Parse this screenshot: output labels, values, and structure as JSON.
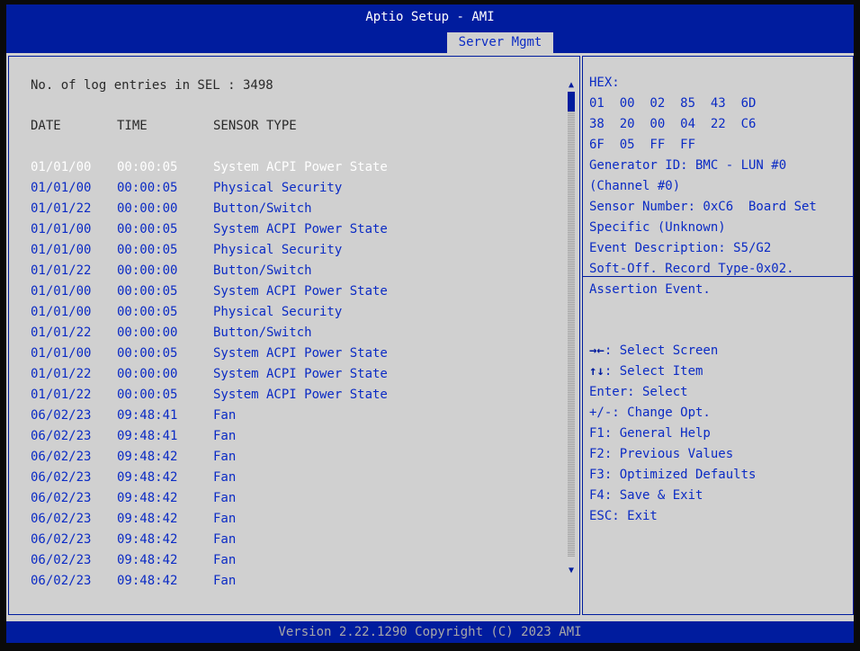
{
  "header": {
    "title": "Aptio Setup - AMI",
    "tab": "Server Mgmt"
  },
  "main": {
    "entries_label": "No. of log entries in SEL : 3498",
    "columns": [
      "DATE",
      "TIME",
      "SENSOR TYPE"
    ],
    "rows": [
      {
        "date": "01/01/00",
        "time": "00:00:05",
        "sensor": "System ACPI Power State"
      },
      {
        "date": "01/01/00",
        "time": "00:00:05",
        "sensor": "Physical Security"
      },
      {
        "date": "01/01/22",
        "time": "00:00:00",
        "sensor": "Button/Switch"
      },
      {
        "date": "01/01/00",
        "time": "00:00:05",
        "sensor": "System ACPI Power State"
      },
      {
        "date": "01/01/00",
        "time": "00:00:05",
        "sensor": "Physical Security"
      },
      {
        "date": "01/01/22",
        "time": "00:00:00",
        "sensor": "Button/Switch"
      },
      {
        "date": "01/01/00",
        "time": "00:00:05",
        "sensor": "System ACPI Power State"
      },
      {
        "date": "01/01/00",
        "time": "00:00:05",
        "sensor": "Physical Security"
      },
      {
        "date": "01/01/22",
        "time": "00:00:00",
        "sensor": "Button/Switch"
      },
      {
        "date": "01/01/00",
        "time": "00:00:05",
        "sensor": "System ACPI Power State"
      },
      {
        "date": "01/01/22",
        "time": "00:00:00",
        "sensor": "System ACPI Power State"
      },
      {
        "date": "01/01/22",
        "time": "00:00:05",
        "sensor": "System ACPI Power State"
      },
      {
        "date": "06/02/23",
        "time": "09:48:41",
        "sensor": "Fan"
      },
      {
        "date": "06/02/23",
        "time": "09:48:41",
        "sensor": "Fan"
      },
      {
        "date": "06/02/23",
        "time": "09:48:42",
        "sensor": "Fan"
      },
      {
        "date": "06/02/23",
        "time": "09:48:42",
        "sensor": "Fan"
      },
      {
        "date": "06/02/23",
        "time": "09:48:42",
        "sensor": "Fan"
      },
      {
        "date": "06/02/23",
        "time": "09:48:42",
        "sensor": "Fan"
      },
      {
        "date": "06/02/23",
        "time": "09:48:42",
        "sensor": "Fan"
      },
      {
        "date": "06/02/23",
        "time": "09:48:42",
        "sensor": "Fan"
      },
      {
        "date": "06/02/23",
        "time": "09:48:42",
        "sensor": "Fan"
      }
    ]
  },
  "details": {
    "lines": [
      "HEX:",
      "01  00  02  85  43  6D",
      "38  20  00  04  22  C6",
      "6F  05  FF  FF",
      "Generator ID: BMC - LUN #0",
      "(Channel #0)",
      "Sensor Number: 0xC6  Board Set",
      "Specific (Unknown)",
      "Event Description: S5/G2",
      "Soft-Off. Record Type-0x02.",
      "Assertion Event."
    ]
  },
  "help": [
    {
      "key": "→←",
      "text": ": Select Screen"
    },
    {
      "key": "↑↓",
      "text": ": Select Item"
    },
    {
      "key": "",
      "text": "Enter: Select"
    },
    {
      "key": "",
      "text": "+/-: Change Opt."
    },
    {
      "key": "",
      "text": "F1: General Help"
    },
    {
      "key": "",
      "text": "F2: Previous Values"
    },
    {
      "key": "",
      "text": "F3: Optimized Defaults"
    },
    {
      "key": "",
      "text": "F4: Save & Exit"
    },
    {
      "key": "",
      "text": "ESC: Exit"
    }
  ],
  "footer": {
    "text": "Version 2.22.1290 Copyright (C) 2023 AMI"
  },
  "colors": {
    "header_bg": "#001c9e",
    "panel_bg": "#d0d0d0",
    "text_blue": "#0b2bc4",
    "selected_text": "#ffffff"
  },
  "selected_row": 0
}
